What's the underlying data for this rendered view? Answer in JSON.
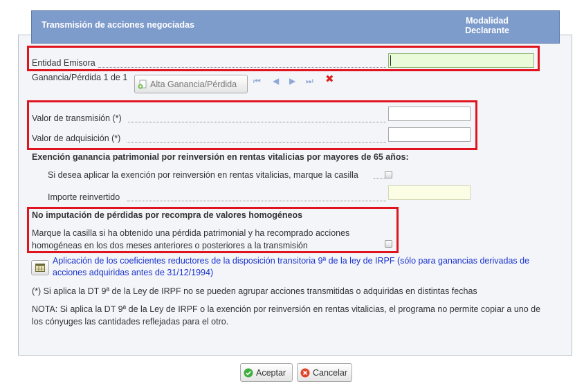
{
  "header": {
    "title": "Transmisión de acciones negociadas",
    "right_line1": "Modalidad",
    "right_line2": "Declarante"
  },
  "entidad": {
    "label": "Entidad Emisora",
    "value": ""
  },
  "ganancia": {
    "counter": "Ganancia/Pérdida 1 de 1",
    "alta_label": "Alta Ganancia/Pérdida"
  },
  "valor_transmision": {
    "label": "Valor de transmisión (*)",
    "value": ""
  },
  "valor_adquisicion": {
    "label": "Valor de adquisición (*)",
    "value": ""
  },
  "exencion": {
    "heading": "Exención ganancia patrimonial por reinversión en rentas vitalicias por mayores de 65 años:",
    "checkbox_label": "Si desea aplicar la exención por reinversión en rentas vitalicias, marque la casilla",
    "importe_label": "Importe reinvertido"
  },
  "no_imputacion": {
    "heading": "No imputación de pérdidas por recompra de valores homogéneos",
    "text_line1": "Marque la casilla si ha obtenido una pérdida patrimonial y ha recomprado acciones",
    "text_line2": "homogéneas en los dos meses anteriores o posteriores a la transmisión"
  },
  "coeficientes_link": {
    "line1": "Aplicación de los coeficientes reductores de la disposición transitoria 9ª de la ley de IRPF (sólo para ganancias derivadas de",
    "line2": "acciones adquiridas antes de 31/12/1994)"
  },
  "note_dt9": "(*) Si aplica la DT 9ª de la Ley de IRPF no se pueden agrupar acciones transmitidas o adquiridas en distintas fechas",
  "nota": {
    "line1": "NOTA: Si aplica la DT 9ª de la Ley de IRPF o la exención por reinversión en rentas vitalicias, el programa no permite copiar a uno de",
    "line2": "los cónyuges las cantidades reflejadas para el otro."
  },
  "buttons": {
    "aceptar": "Aceptar",
    "cancelar": "Cancelar"
  },
  "colors": {
    "header_bg": "#7e9ccb",
    "highlight_red": "#e0141e",
    "link_blue": "#1a33cc",
    "input_green": "#e9fbd9",
    "input_yellow": "#fbfde5"
  }
}
